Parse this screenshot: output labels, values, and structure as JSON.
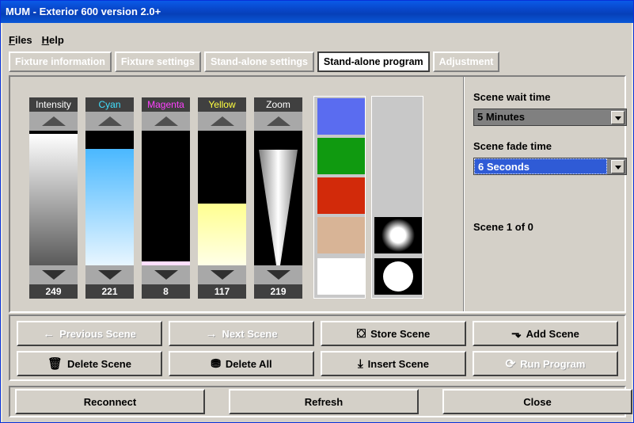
{
  "window": {
    "title": "MUM - Exterior 600 version 2.0+"
  },
  "menu": [
    {
      "label": "Files",
      "access": "F",
      "rest": "iles"
    },
    {
      "label": "Help",
      "access": "H",
      "rest": "elp"
    }
  ],
  "tabs": [
    {
      "label": "Fixture information",
      "active": false
    },
    {
      "label": "Fixture settings",
      "active": false
    },
    {
      "label": "Stand-alone settings",
      "active": false
    },
    {
      "label": "Stand-alone program",
      "active": true
    },
    {
      "label": "Adjustment",
      "active": false
    }
  ],
  "sliders": [
    {
      "label": "Intensity",
      "label_color": "#ffffff",
      "value": "249",
      "level": 0.977,
      "fill_gradient": "linear-gradient(#ffffff, #5a5a5a)"
    },
    {
      "label": "Cyan",
      "label_color": "#40e0ff",
      "value": "221",
      "level": 0.867,
      "fill_gradient": "linear-gradient(#4ab8ff, #e8f6ff)"
    },
    {
      "label": "Magenta",
      "label_color": "#ff40ff",
      "value": "8",
      "level": 0.031,
      "fill_gradient": "linear-gradient(#ffe0ff, #ffe0ff)"
    },
    {
      "label": "Yellow",
      "label_color": "#ffff40",
      "value": "117",
      "level": 0.459,
      "fill_gradient": "linear-gradient(#ffff90, #ffffe8)"
    },
    {
      "label": "Zoom",
      "label_color": "#ffffff",
      "value": "219",
      "level": 0.859,
      "fill_gradient": "none"
    }
  ],
  "color_swatches": [
    "#5a6cf0",
    "#109a10",
    "#d22a0a",
    "#d8b496",
    "#ffffff"
  ],
  "gobo_icons": [
    "soft-spot-gobo-icon",
    "hard-spot-gobo-icon"
  ],
  "scene_wait": {
    "label": "Scene wait time",
    "value": "5 Minutes"
  },
  "scene_fade": {
    "label": "Scene fade time",
    "value": "6 Seconds"
  },
  "scene_count": "Scene 1 of 0",
  "actions": [
    {
      "label": "Previous Scene",
      "icon": "←",
      "icon_name": "arrow-left-icon",
      "enabled": false
    },
    {
      "label": "Next Scene",
      "icon": "→",
      "icon_name": "arrow-right-icon",
      "enabled": false
    },
    {
      "label": "Store Scene",
      "icon": "⛋",
      "icon_name": "store-icon",
      "enabled": true
    },
    {
      "label": "Add Scene",
      "icon": "⬎",
      "icon_name": "add-icon",
      "enabled": true
    },
    {
      "label": "Delete Scene",
      "icon": "🗑",
      "icon_name": "trash-icon",
      "enabled": true
    },
    {
      "label": "Delete All",
      "icon": "⛃",
      "icon_name": "trash-all-icon",
      "enabled": true
    },
    {
      "label": "Insert Scene",
      "icon": "⤓",
      "icon_name": "insert-icon",
      "enabled": true
    },
    {
      "label": "Run Program",
      "icon": "⟳",
      "icon_name": "run-icon",
      "enabled": false
    }
  ],
  "bottom": {
    "reconnect": "Reconnect",
    "refresh": "Refresh",
    "close": "Close"
  }
}
